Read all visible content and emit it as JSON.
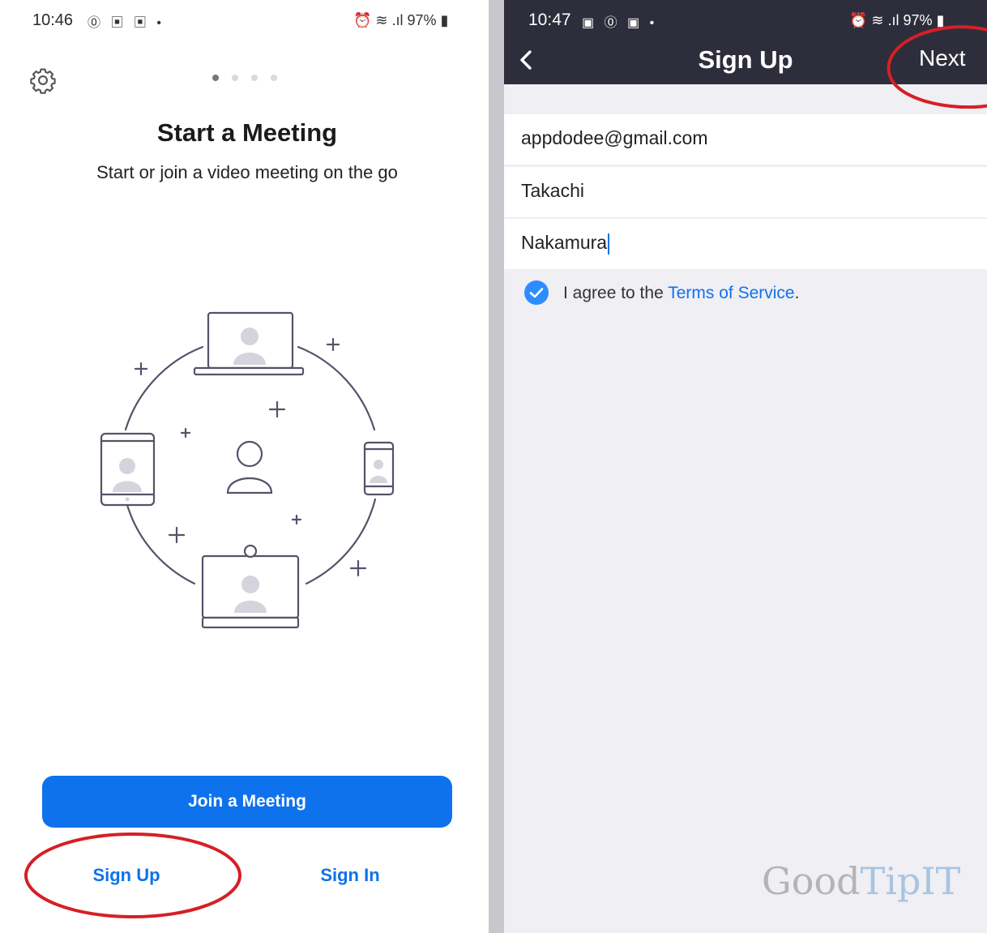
{
  "left": {
    "status": {
      "time": "10:46",
      "icons": "⓪ ▣ ▣ •",
      "right": "⏰ ≋ .ıl 97% ▮"
    },
    "page_dots": {
      "count": 4,
      "active": 1
    },
    "title": "Start a Meeting",
    "subtitle": "Start or join a video meeting on the go",
    "join_label": "Join a Meeting",
    "signup_label": "Sign Up",
    "signin_label": "Sign In",
    "accent": "#0e72ed"
  },
  "right": {
    "status": {
      "time": "10:47",
      "icons": "▣ ⓪ ▣ •",
      "right": "⏰ ≋ .ıl 97% ▮"
    },
    "title": "Sign Up",
    "next_label": "Next",
    "fields": {
      "email": "appdodee@gmail.com",
      "first_name": "Takachi",
      "last_name": "Nakamura"
    },
    "agree": {
      "checked": true,
      "prefix": "I agree to the ",
      "link": "Terms of Service",
      "suffix": "."
    },
    "watermark": {
      "part1": "Good",
      "part2": "TipIT"
    },
    "header_color": "#2d2d3b"
  },
  "annotation_color": "#d61f26"
}
